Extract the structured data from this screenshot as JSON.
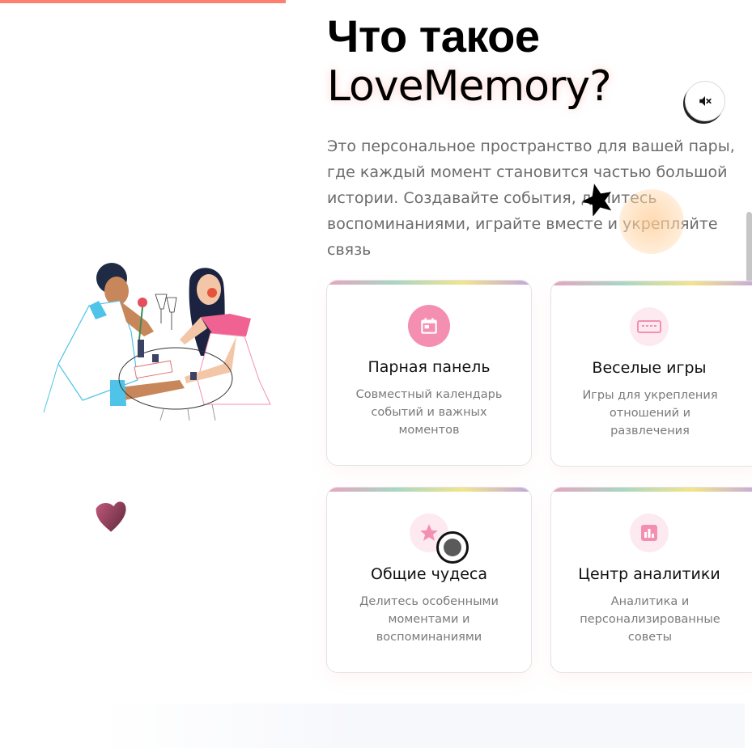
{
  "hero": {
    "title_line1": "Что такое",
    "title_line2": "LoveMemory?",
    "intro": "Это персональное пространство для вашей пары,\nгде каждый момент становится частью большой\nистории. Создавайте события, делитесь\nвоспоминаниями, играйте вместе и укрепляйте связь"
  },
  "controls": {
    "mute_icon": "volume-mute-icon"
  },
  "features": [
    {
      "icon": "calendar-icon",
      "title": "Парная панель",
      "description": "Совместный календарь событий и важных моментов"
    },
    {
      "icon": "keyboard-icon",
      "title": "Веселые игры",
      "description": "Игры для укрепления отношений и развлечения"
    },
    {
      "icon": "star-icon",
      "title": "Общие чудеса",
      "description": "Делитесь особенными моментами и воспоминаниями"
    },
    {
      "icon": "bar-chart-icon",
      "title": "Центр аналитики",
      "description": "Аналитика и персонализированные советы"
    }
  ],
  "colors": {
    "accent": "#f48fb1",
    "top_bar": "#ff7f6e",
    "heart": "#8a3a55"
  }
}
